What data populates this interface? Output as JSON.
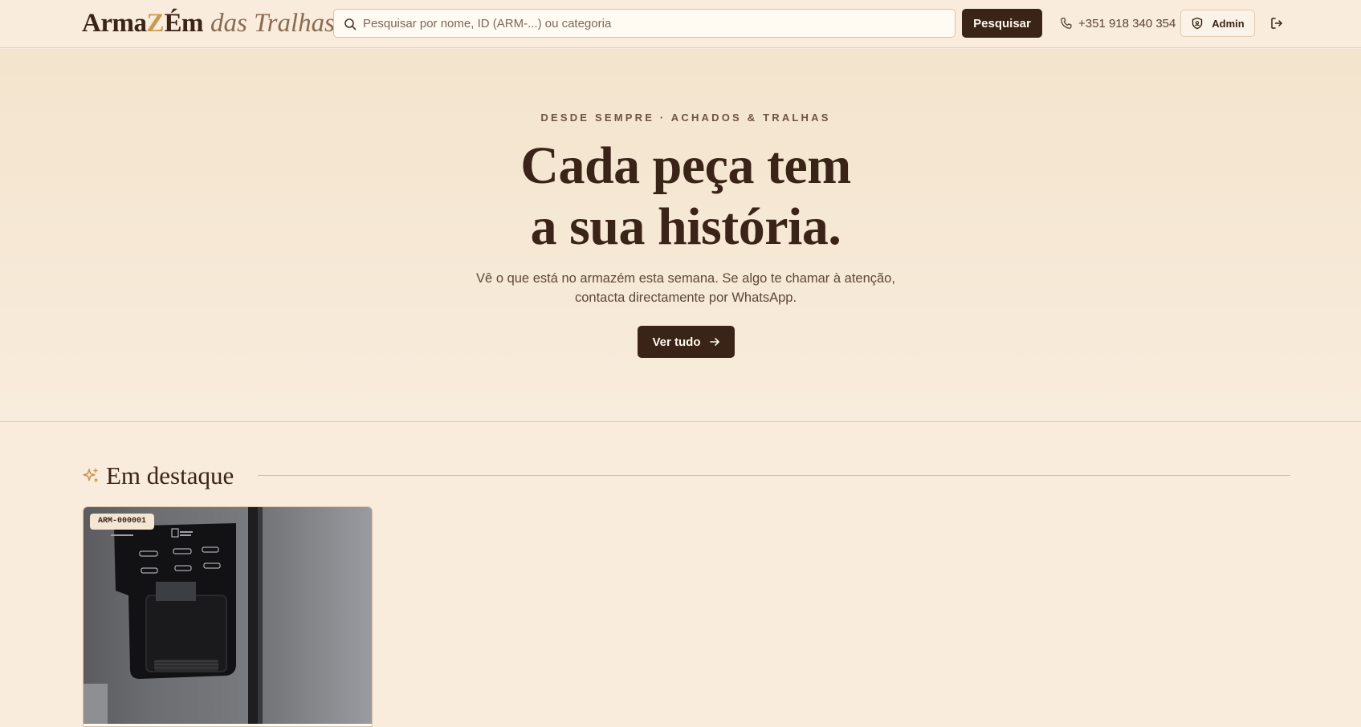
{
  "header": {
    "logo": {
      "part1": "Arma",
      "part_z": "Z",
      "part_em": "Ém",
      "part2": "das Tralhas"
    },
    "search": {
      "placeholder": "Pesquisar por nome, ID (ARM-...) ou categoria",
      "value": ""
    },
    "search_button": "Pesquisar",
    "phone": "+351 918 340 354",
    "admin_button": "Admin",
    "icons": [
      "search-icon",
      "phone-icon",
      "shield-icon",
      "logout-icon"
    ]
  },
  "hero": {
    "eyebrow": "DESDE SEMPRE · ACHADOS & TRALHAS",
    "headline_line1": "Cada peça tem",
    "headline_line2": "a sua história.",
    "subtext_line1": "Vê o que está no armazém esta semana. Se algo te chamar à atenção,",
    "subtext_line2": "contacta directamente por WhatsApp.",
    "cta": "Ver tudo"
  },
  "featured": {
    "title": "Em destaque",
    "items": [
      {
        "id": "ARM-000001"
      }
    ]
  },
  "colors": {
    "background": "#f9ecdc",
    "primary_dark": "#3a2418",
    "accent_gold": "#c99a55",
    "border": "#d9c4a6"
  }
}
